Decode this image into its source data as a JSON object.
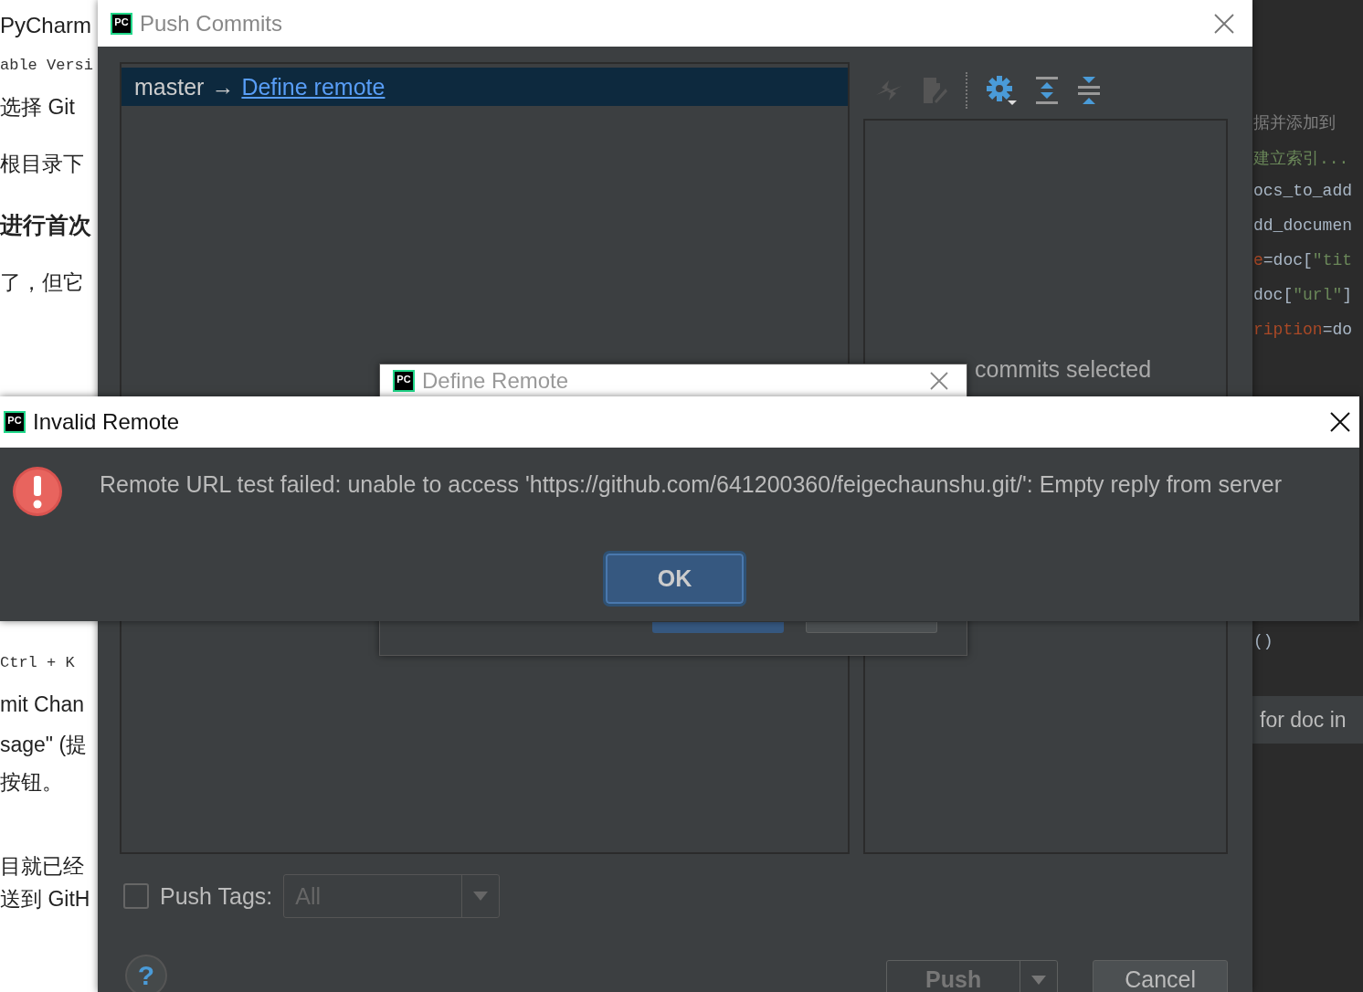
{
  "background_document": {
    "lines": [
      {
        "text": "PyCharm",
        "kind": "heading"
      },
      {
        "text": "able Versi",
        "kind": "mono"
      },
      {
        "text": "选择 Git",
        "kind": "mixed"
      },
      {
        "text": "根目录下",
        "kind": "plain"
      },
      {
        "text": "进行首次",
        "kind": "bold"
      },
      {
        "text": "了，但它",
        "kind": "plain"
      },
      {
        "text": "Ctrl + K",
        "kind": "mono"
      },
      {
        "text": "mit Chan",
        "kind": "plain"
      },
      {
        "text": "sage\" (提",
        "kind": "plain"
      },
      {
        "text": "按钮。",
        "kind": "plain"
      },
      {
        "text": "目就已经",
        "kind": "plain"
      },
      {
        "text": "送到 GitH",
        "kind": "plain"
      }
    ]
  },
  "editor": {
    "lines": [
      [
        {
          "text": "据并添加到",
          "kind": "comment"
        }
      ],
      [
        {
          "text": "建立索引...",
          "kind": "string"
        }
      ],
      [
        {
          "text": "ocs_to_add",
          "kind": "code"
        }
      ],
      [
        {
          "text": "dd_documen",
          "kind": "code"
        }
      ],
      [
        {
          "text": "e",
          "kind": "param"
        },
        {
          "text": "=doc[",
          "kind": "code"
        },
        {
          "text": "\"tit",
          "kind": "string"
        }
      ],
      [
        {
          "text": "doc[",
          "kind": "code"
        },
        {
          "text": "\"url\"",
          "kind": "string"
        },
        {
          "text": "]",
          "kind": "code"
        }
      ],
      [
        {
          "text": "ription",
          "kind": "param"
        },
        {
          "text": "=do",
          "kind": "code"
        }
      ],
      [
        {
          "text": "()",
          "kind": "code"
        }
      ]
    ],
    "console_line": "for doc in"
  },
  "push_dialog": {
    "title": "Push Commits",
    "icon_text": "PC",
    "branch": {
      "source": "master",
      "arrow": "→",
      "target": "Define remote",
      "selected": true
    },
    "details_text": "commits selected",
    "push_tags": {
      "label": "Push Tags:",
      "checked": false,
      "value": "All",
      "disabled": true
    },
    "help": "?",
    "buttons": [
      {
        "label": "Push",
        "kind": "split",
        "disabled": true
      },
      {
        "label": "Cancel",
        "kind": "plain",
        "disabled": false
      }
    ]
  },
  "define_remote": {
    "title": "Define Remote",
    "icon_text": "PC"
  },
  "error_dialog": {
    "title": "Invalid Remote",
    "icon_text": "PC",
    "message": "Remote URL test failed: unable to access 'https://github.com/641200360/feigechaunshu.git/': Empty reply from server",
    "button": "OK"
  }
}
